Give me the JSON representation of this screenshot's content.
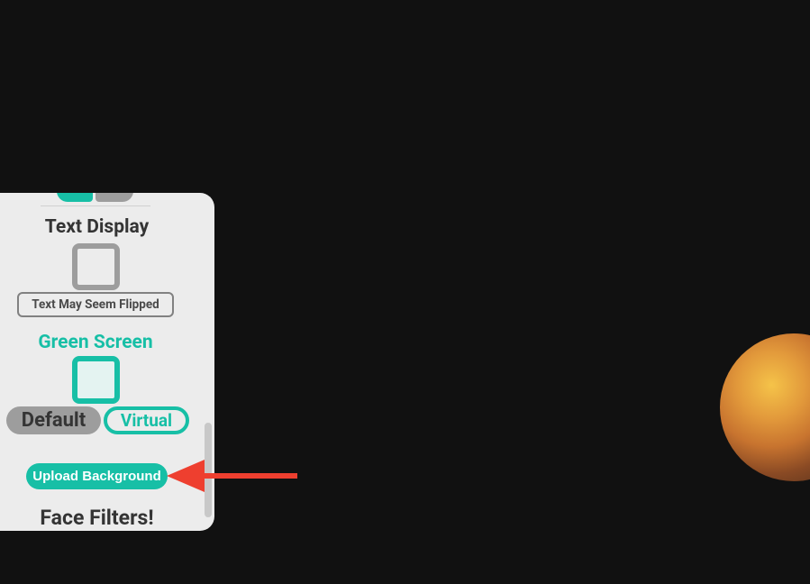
{
  "panel": {
    "text_display_label": "Text Display",
    "flip_label": "Text May Seem Flipped",
    "green_screen_label": "Green Screen",
    "toggle_default": "Default",
    "toggle_virtual": "Virtual",
    "upload_button": "Upload Background",
    "face_filters_label": "Face Filters!"
  }
}
